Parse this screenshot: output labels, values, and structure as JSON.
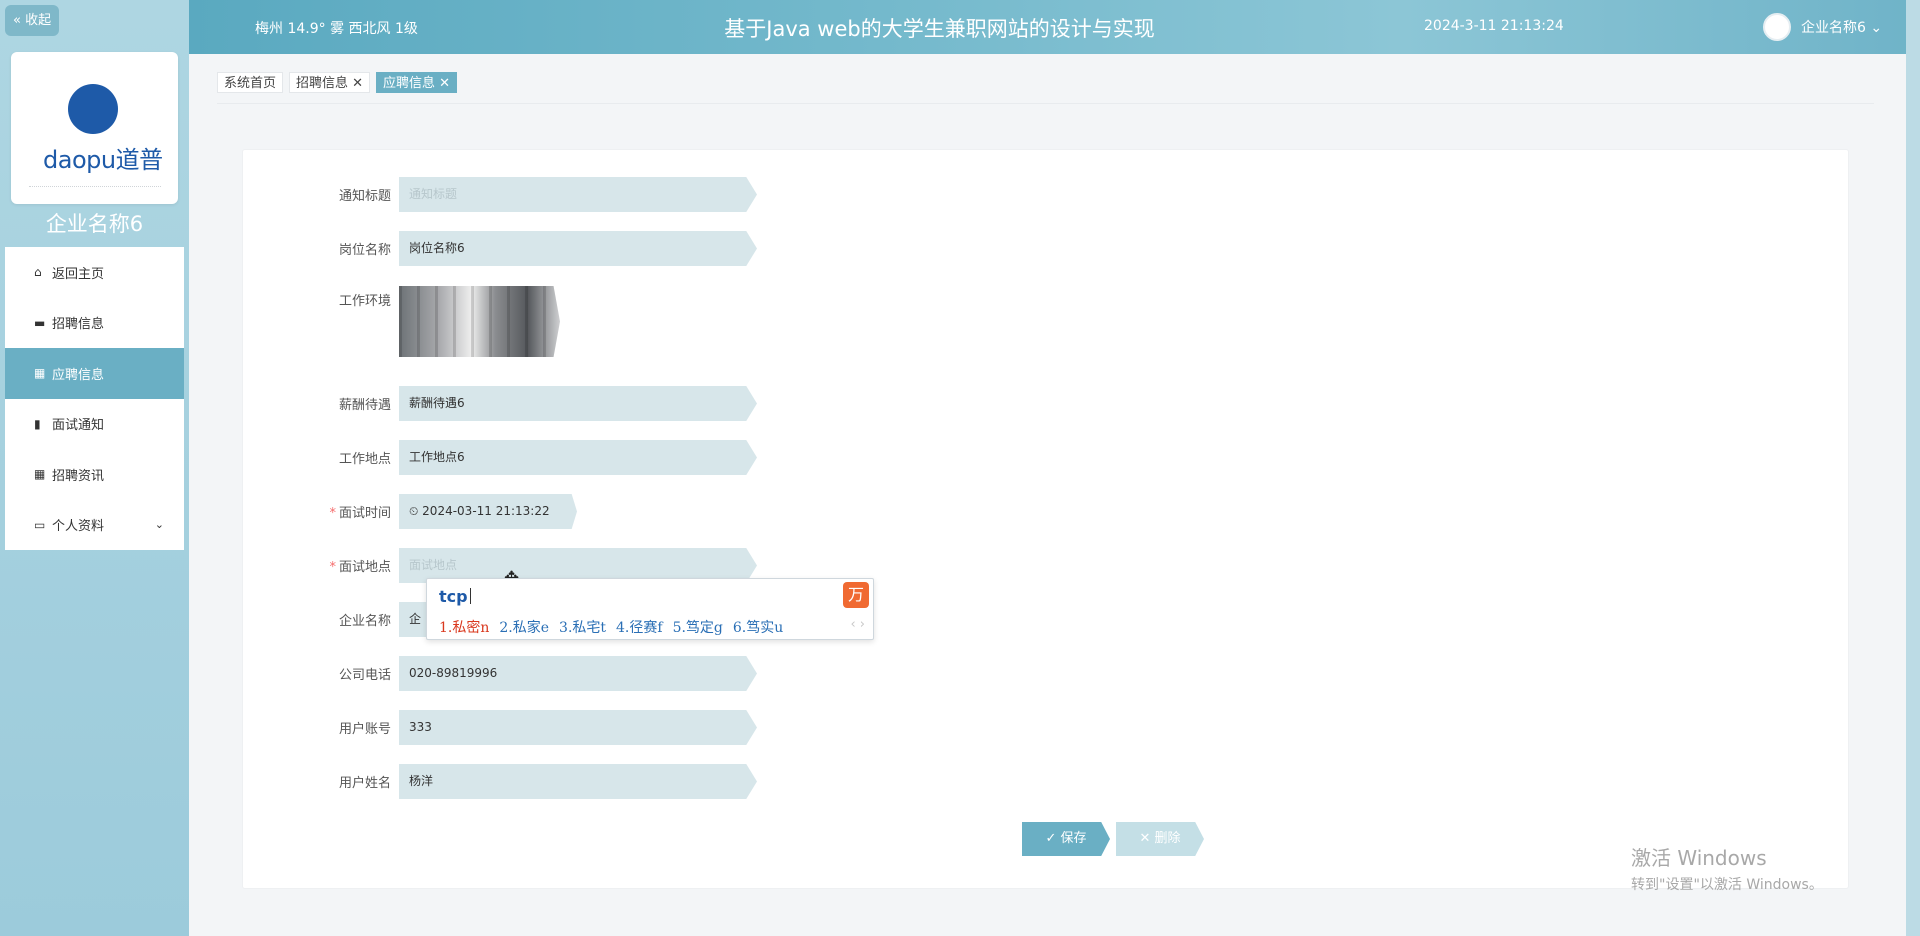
{
  "sidebar": {
    "collapse_label": "« 收起",
    "logo_text": "daopu道普",
    "company_name": "企业名称6",
    "items": [
      {
        "label": "返回主页",
        "icon": "home-icon"
      },
      {
        "label": "招聘信息",
        "icon": "briefcase-icon"
      },
      {
        "label": "应聘信息",
        "icon": "grid-icon"
      },
      {
        "label": "面试通知",
        "icon": "clipboard-icon"
      },
      {
        "label": "招聘资讯",
        "icon": "grid-icon"
      },
      {
        "label": "个人资料",
        "icon": "card-icon"
      }
    ]
  },
  "header": {
    "weather": "梅州  14.9°  雾  西北风  1级",
    "title": "基于Java web的大学生兼职网站的设计与实现",
    "datetime": "2024-3-11 21:13:24",
    "user_name": "企业名称6 ⌄"
  },
  "tabs": [
    {
      "label": "系统首页"
    },
    {
      "label": "招聘信息 ✕"
    },
    {
      "label": "应聘信息 ✕"
    }
  ],
  "form": {
    "fields": [
      {
        "label": "通知标题",
        "value": "",
        "placeholder": "通知标题",
        "required": false
      },
      {
        "label": "岗位名称",
        "value": "岗位名称6",
        "required": false
      },
      {
        "label": "工作环境",
        "value": "",
        "required": false
      },
      {
        "label": "薪酬待遇",
        "value": "薪酬待遇6",
        "required": false
      },
      {
        "label": "工作地点",
        "value": "工作地点6",
        "required": false
      },
      {
        "label": "面试时间",
        "value": "⏲ 2024-03-11 21:13:22",
        "required": true
      },
      {
        "label": "面试地点",
        "value": "",
        "placeholder": "面试地点",
        "required": true
      },
      {
        "label": "企业名称",
        "value": "企",
        "required": false
      },
      {
        "label": "公司电话",
        "value": "020-89819996",
        "required": false
      },
      {
        "label": "用户账号",
        "value": "333",
        "required": false
      },
      {
        "label": "用户姓名",
        "value": "杨洋",
        "required": false
      }
    ],
    "save_label": "✓ 保存",
    "delete_label": "✕ 删除"
  },
  "ime": {
    "input": "tcp",
    "candidates": [
      "1.私密n",
      "2.私家e",
      "3.私宅t",
      "4.径赛f",
      "5.笃定g",
      "6.笃实u"
    ],
    "arrows": "‹ ›",
    "logo_glyph": "万"
  },
  "watermark": {
    "line1": "激活 Windows",
    "line2": "转到\"设置\"以激活 Windows。"
  },
  "colors": {
    "accent": "#6aafc4",
    "field_bg": "#d7e6ea",
    "required": "#f56c6c"
  }
}
